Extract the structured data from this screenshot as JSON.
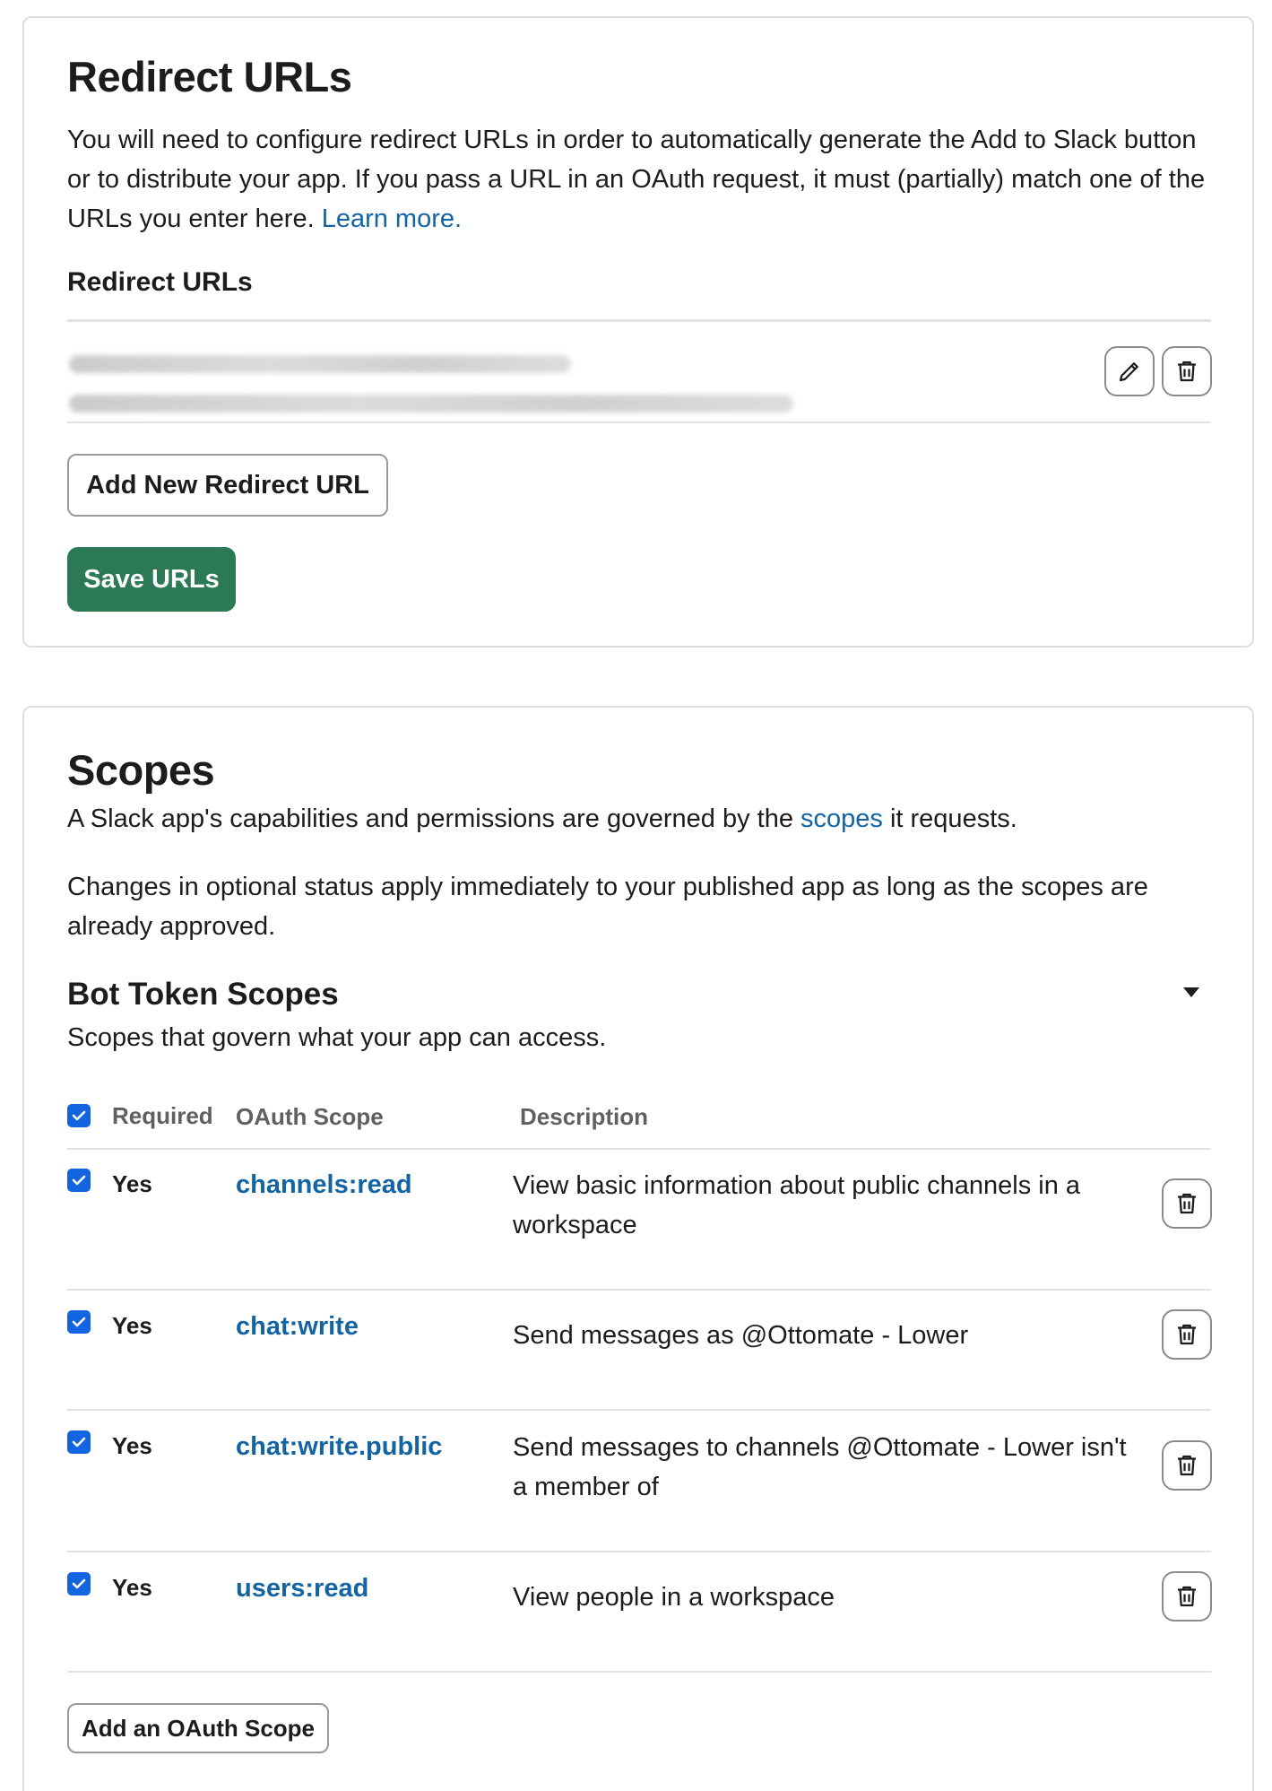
{
  "redirect": {
    "title": "Redirect URLs",
    "description_before_link": "You will need to configure redirect URLs in order to automatically generate the Add to Slack button or to distribute your app. If you pass a URL in an OAuth request, it must (partially) match one of the URLs you enter here. ",
    "learn_more_label": "Learn more.",
    "list_heading": "Redirect URLs",
    "add_button_label": "Add New Redirect URL",
    "save_button_label": "Save URLs"
  },
  "scopes": {
    "title": "Scopes",
    "intro_before_link": "A Slack app's capabilities and permissions are governed by the ",
    "intro_link": "scopes",
    "intro_after_link": " it requests.",
    "optional_note": "Changes in optional status apply immediately to your published app as long as the scopes are already approved.",
    "bot": {
      "title": "Bot Token Scopes",
      "subtitle": "Scopes that govern what your app can access.",
      "columns": {
        "required": "Required",
        "scope": "OAuth Scope",
        "description": "Description"
      },
      "rows": [
        {
          "required": "Yes",
          "scope": "channels:read",
          "description": "View basic information about public channels in a workspace"
        },
        {
          "required": "Yes",
          "scope": "chat:write",
          "description": "Send messages as @Ottomate - Lower"
        },
        {
          "required": "Yes",
          "scope": "chat:write.public",
          "description": "Send messages to channels @Ottomate - Lower isn't a member of"
        },
        {
          "required": "Yes",
          "scope": "users:read",
          "description": "View people in a workspace"
        }
      ],
      "add_button_label": "Add an OAuth Scope"
    }
  },
  "colors": {
    "accent_link": "#1264a3",
    "save_button": "#2c7a55",
    "checkbox": "#1264e0"
  },
  "icons": [
    "pencil-icon",
    "trash-icon",
    "check-icon",
    "caret-down-icon"
  ]
}
